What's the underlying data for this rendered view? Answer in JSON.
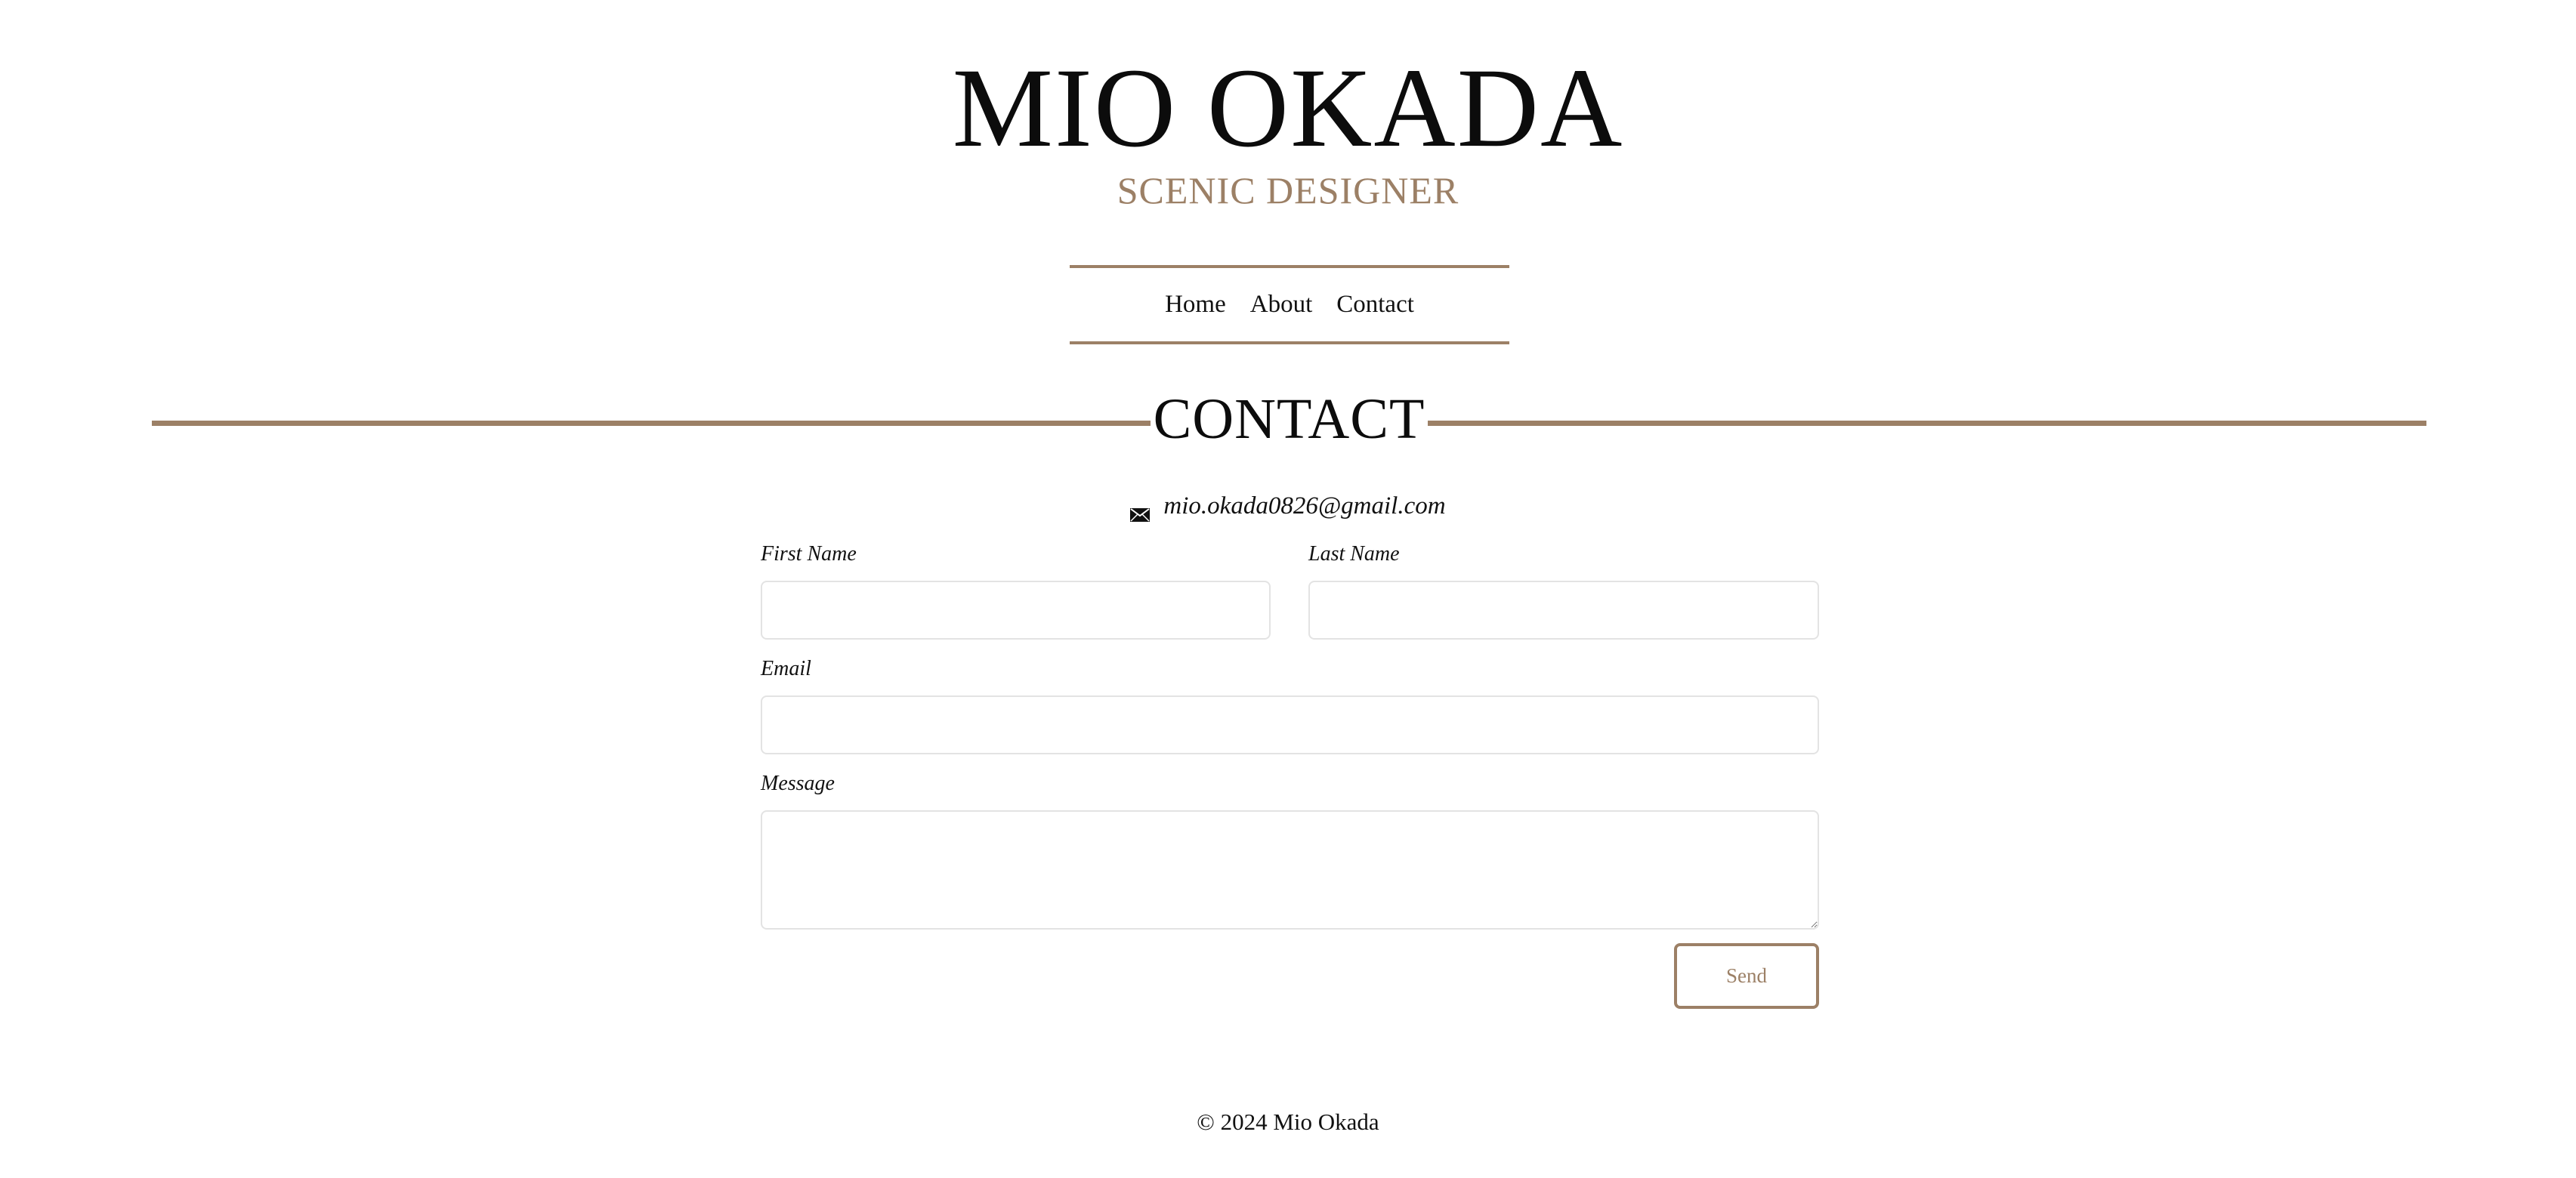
{
  "header": {
    "name": "MIO OKADA",
    "subtitle": "SCENIC DESIGNER"
  },
  "nav": {
    "items": [
      {
        "label": "Home"
      },
      {
        "label": "About"
      },
      {
        "label": "Contact"
      }
    ]
  },
  "section": {
    "title": "CONTACT"
  },
  "contact": {
    "icon": "envelope-icon",
    "email": "mio.okada0826@gmail.com"
  },
  "form": {
    "first_name_label": "First Name",
    "first_name_value": "",
    "last_name_label": "Last Name",
    "last_name_value": "",
    "email_label": "Email",
    "email_value": "",
    "message_label": "Message",
    "message_value": "",
    "send_label": "Send"
  },
  "footer": {
    "text": "© 2024 Mio Okada"
  },
  "colors": {
    "accent": "#9c8066",
    "text": "#111111",
    "field_border": "#e3e3e3",
    "background": "#ffffff"
  }
}
